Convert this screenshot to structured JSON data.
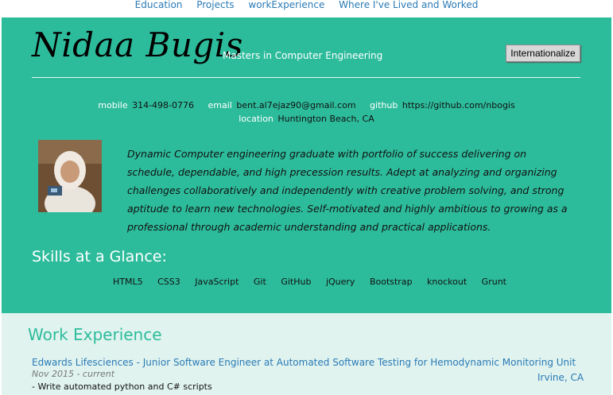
{
  "nav": {
    "items": [
      "Education",
      "Projects",
      "workExperience",
      "Where I've Lived and Worked"
    ]
  },
  "header": {
    "name": "Nidaa Bugis",
    "role": "Masters in Computer Engineering",
    "internationalize_label": "Internationalize"
  },
  "contacts": {
    "mobile_label": "mobile",
    "mobile": "314-498-0776",
    "email_label": "email",
    "email": "bent.al7ejaz90@gmail.com",
    "github_label": "github",
    "github": "https://github.com/nbogis",
    "location_label": "location",
    "location": "Huntington Beach, CA"
  },
  "summary": "Dynamic Computer engineering graduate with portfolio of success delivering on schedule, dependable, and high precession results. Adept at analyzing and organizing challenges collaboratively and independently with creative problem solving, and strong aptitude to learn new technologies. Self-motivated and highly ambitious to growing as a professional through academic understanding and practical applications.",
  "skills": {
    "title": "Skills at a Glance:",
    "items": [
      "HTML5",
      "CSS3",
      "JavaScript",
      "Git",
      "GitHub",
      "jQuery",
      "Bootstrap",
      "knockout",
      "Grunt"
    ]
  },
  "work": {
    "title": "Work Experience",
    "jobs": [
      {
        "title": "Edwards Lifesciences - Junior Software Engineer at Automated Software Testing for Hemodynamic Monitoring Unit",
        "dates": "Nov 2015 - current",
        "location": "Irvine, CA",
        "description": "- Write automated python and C# scripts"
      }
    ]
  },
  "colors": {
    "header_bg": "#2dbc9b",
    "work_bg": "#e0f3ef",
    "link": "#2a7ab5"
  }
}
